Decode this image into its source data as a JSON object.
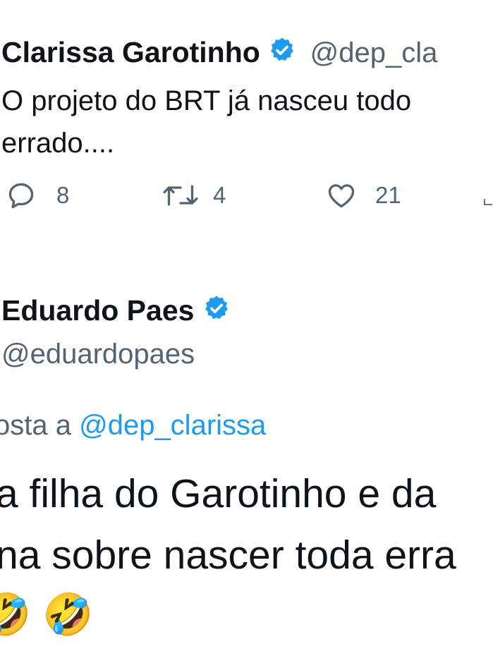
{
  "tweet1": {
    "display_name": "Clarissa Garotinho",
    "handle": "@dep_cla",
    "text_line1": "O projeto do BRT já nasceu todo",
    "text_line2": "errado....",
    "replies": "8",
    "retweets": "4",
    "likes": "21",
    "icons": [
      "reply-icon",
      "retweet-icon",
      "like-icon",
      "share-icon"
    ]
  },
  "tweet2": {
    "display_name": "Eduardo Paes",
    "handle": "@eduardopaes",
    "reply_prefix": "osta a",
    "reply_to": "@dep_clarissa",
    "text_line1": "a filha do Garotinho e da",
    "text_line2": "na sobre nascer toda erra",
    "emoji1": "🤣",
    "emoji2": "🤣"
  },
  "colors": {
    "text": "#0f1419",
    "secondary": "#536471",
    "accent": "#1d9bf0"
  }
}
